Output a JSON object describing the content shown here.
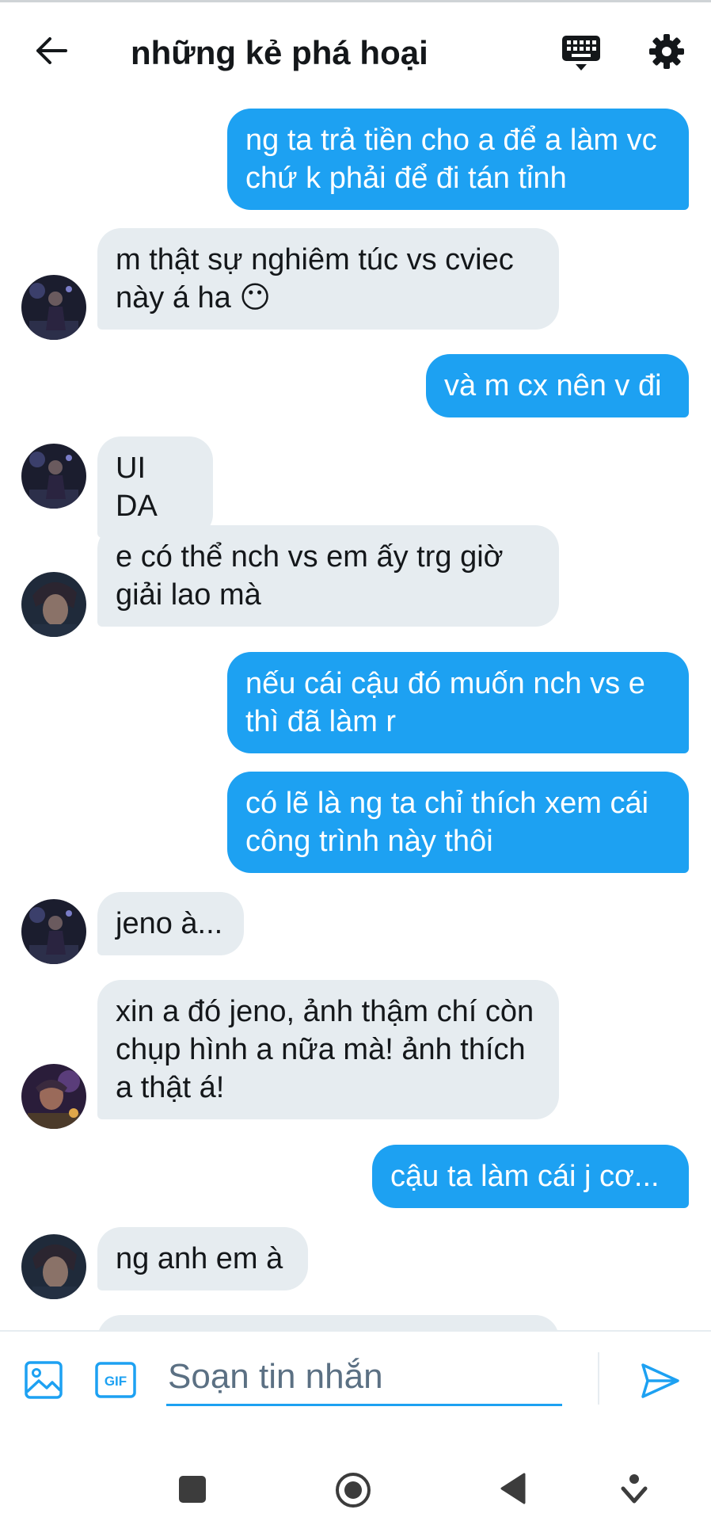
{
  "header": {
    "title": "những kẻ phá hoại",
    "back_icon": "arrow-left-icon",
    "keyboard_icon": "keyboard-icon",
    "settings_icon": "gear-icon"
  },
  "colors": {
    "accent": "#1da1f2",
    "incoming_bubble": "#e6ecf0",
    "text": "#14171a",
    "placeholder": "#5b7083"
  },
  "messages": [
    {
      "direction": "out",
      "text": "ng ta trả tiền cho a để a làm vc chứ k phải để đi tán tỉnh"
    },
    {
      "direction": "in",
      "text": "m thật sự nghiêm túc vs cviec này á ha 😶",
      "avatar": "dark-stage-avatar"
    },
    {
      "direction": "out",
      "text": "và m cx nên v đi"
    },
    {
      "direction": "in",
      "text": "UI DA",
      "avatar": "dark-stage-avatar"
    },
    {
      "direction": "in",
      "text": "e có thể nch vs em ấy trg giờ giải lao mà",
      "avatar": "portrait-avatar"
    },
    {
      "direction": "out",
      "text": "nếu cái cậu đó muốn nch vs e thì đã làm r"
    },
    {
      "direction": "out",
      "text": "có lẽ là ng ta chỉ thích xem cái công trình này thôi"
    },
    {
      "direction": "in",
      "text": "jeno à...",
      "avatar": "dark-stage-avatar"
    },
    {
      "direction": "in",
      "text": "xin a đó jeno, ảnh thậm chí còn chụp hình a nữa mà! ảnh thích a thật á!",
      "avatar": "purple-avatar"
    },
    {
      "direction": "out",
      "text": "cậu ta làm cái j cơ..."
    },
    {
      "direction": "in",
      "text": "ng anh em à",
      "avatar": "portrait-avatar"
    }
  ],
  "composer": {
    "placeholder": "Soạn tin nhắn",
    "image_icon": "image-icon",
    "gif_icon": "gif-icon",
    "gif_label": "GIF",
    "send_icon": "send-icon"
  },
  "navbar": {
    "recents_icon": "square-icon",
    "home_icon": "circle-home-icon",
    "back_icon": "triangle-back-icon",
    "extra_icon": "chevron-down-icon"
  }
}
